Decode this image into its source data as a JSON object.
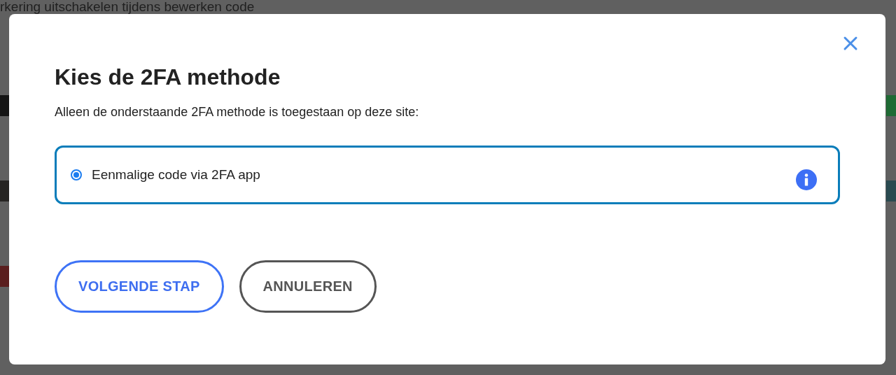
{
  "background": {
    "heading": "rkering uitschakelen tijdens bewerken code"
  },
  "dialog": {
    "title": "Kies de 2FA methode",
    "description": "Alleen de onderstaande 2FA methode is toegestaan op deze site:",
    "options": [
      {
        "label": "Eenmalige code via 2FA app",
        "selected": true
      }
    ],
    "buttons": [
      {
        "label": "VOLGENDE STAP",
        "kind": "primary"
      },
      {
        "label": "ANNULEREN",
        "kind": "secondary"
      }
    ]
  }
}
